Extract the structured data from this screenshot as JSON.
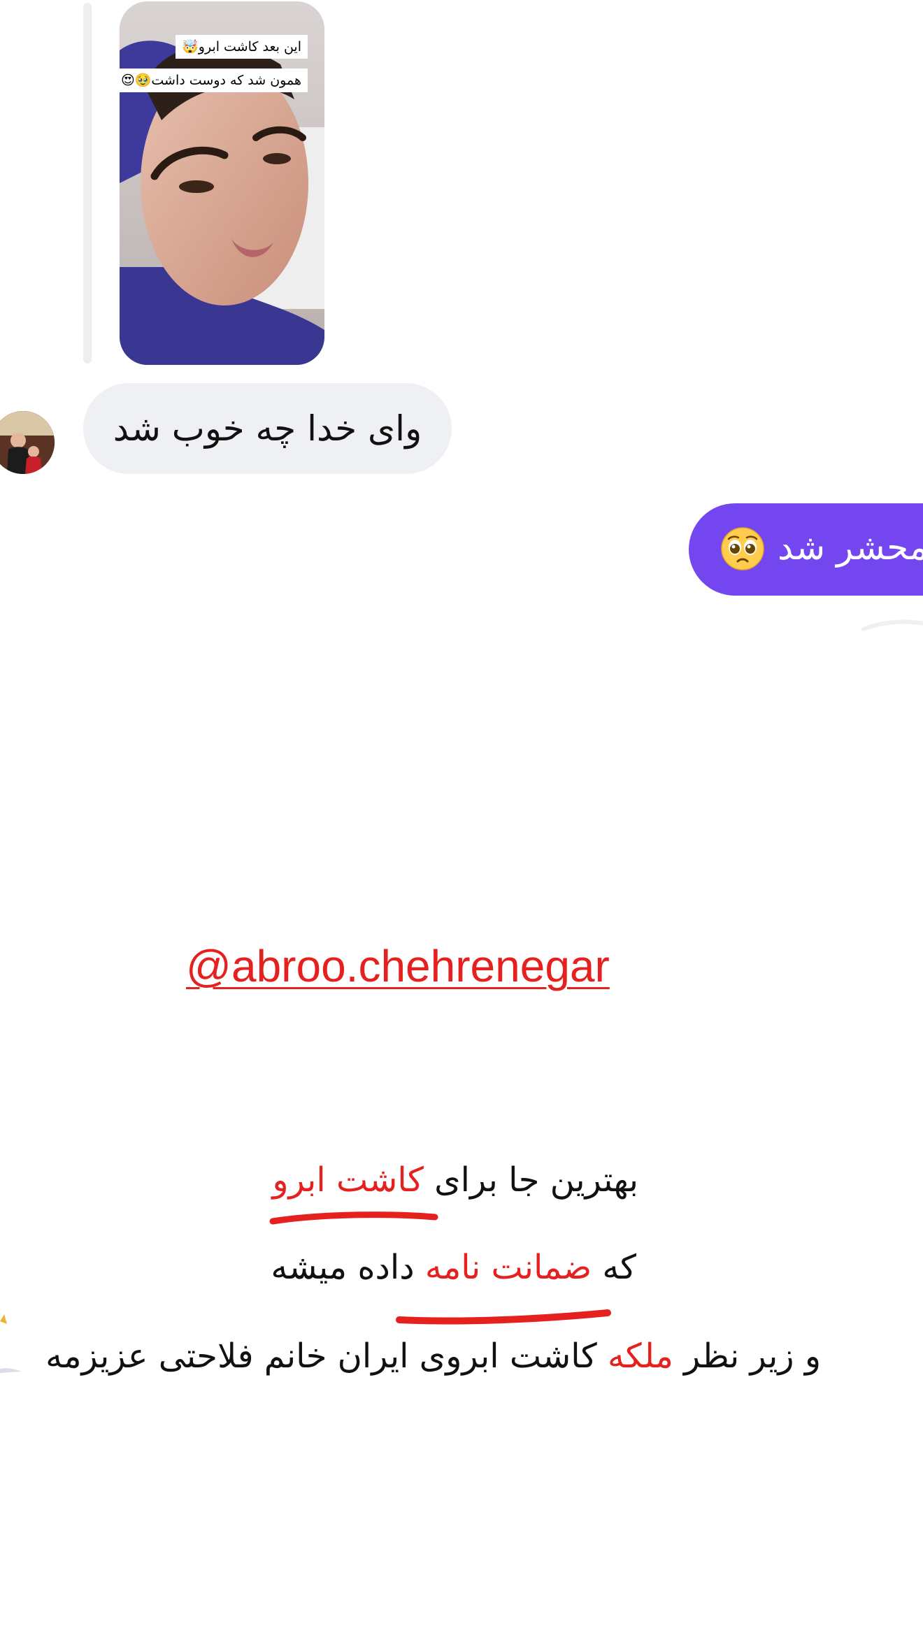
{
  "story_reply": {
    "caption_line_1": "این بعد کاشت ابرو🤯",
    "caption_line_2": "همون شد که دوست داشت🥹😍"
  },
  "incoming_message": {
    "text": "وای خدا چه خوب شد"
  },
  "outgoing_message": {
    "text": "محشر شد",
    "emoji": "pleading-face-emoji"
  },
  "promo": {
    "handle": "@abroo.chehrenegar",
    "line_1_pre": "بهترین جا برای ",
    "line_1_highlight": "کاشت ابرو",
    "line_2_pre": "که ",
    "line_2_highlight": "ضمانت نامه",
    "line_2_post": " داده میشه",
    "line_3_pre": "و زیر نظر ",
    "line_3_highlight": "ملکه",
    "line_3_post": " کاشت ابروی ایران خانم فلاحتی عزیزمه"
  },
  "colors": {
    "accent_purple": "#7346f0",
    "highlight_red": "#e5211f",
    "incoming_bubble": "#eff0f3"
  }
}
